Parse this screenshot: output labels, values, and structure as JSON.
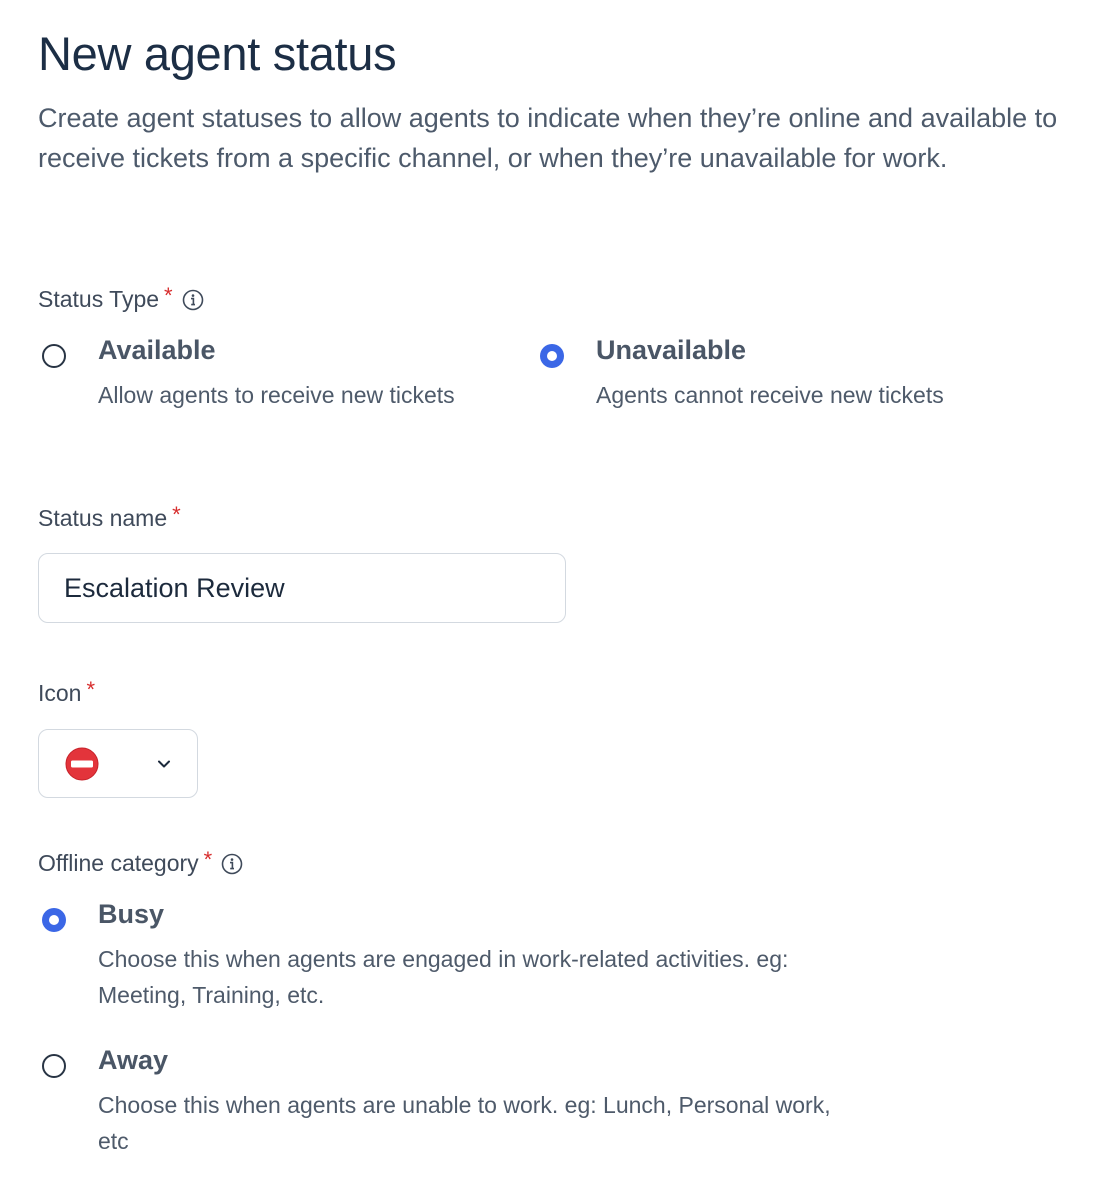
{
  "header": {
    "title": "New agent status",
    "description": "Create agent statuses to allow agents to indicate when they’re online and available to receive tickets from a specific channel, or when they’re unavailable for work."
  },
  "status_type": {
    "label": "Status Type",
    "required_mark": "*",
    "options": [
      {
        "title": "Available",
        "description": "Allow agents to receive new tickets",
        "selected": false
      },
      {
        "title": "Unavailable",
        "description": "Agents cannot receive new tickets",
        "selected": true
      }
    ]
  },
  "status_name": {
    "label": "Status name",
    "required_mark": "*",
    "value": "Escalation Review"
  },
  "icon_field": {
    "label": "Icon",
    "required_mark": "*",
    "selected_icon": "no-entry-icon"
  },
  "offline_category": {
    "label": "Offline category",
    "required_mark": "*",
    "options": [
      {
        "title": "Busy",
        "description": "Choose this when agents are engaged in work-related activities. eg: Meeting, Training, etc.",
        "selected": true
      },
      {
        "title": "Away",
        "description": "Choose this when agents are unable to work. eg: Lunch, Personal work, etc",
        "selected": false
      }
    ]
  },
  "colors": {
    "accent": "#3b67e6",
    "required": "#d72d2d",
    "title_text": "#1c2e45"
  }
}
